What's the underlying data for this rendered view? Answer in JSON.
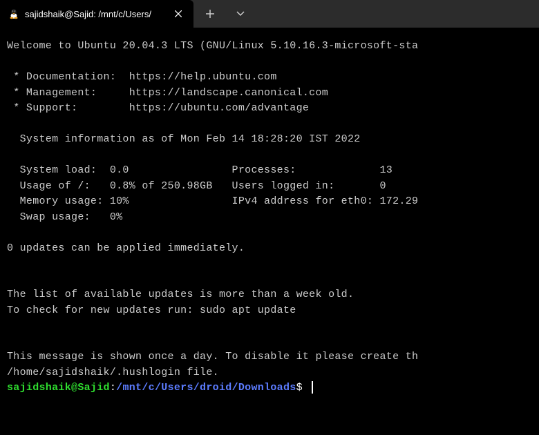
{
  "tab": {
    "title": "sajidshaik@Sajid: /mnt/c/Users/"
  },
  "terminal": {
    "welcome": "Welcome to Ubuntu 20.04.3 LTS (GNU/Linux 5.10.16.3-microsoft-sta",
    "links": {
      "documentation": " * Documentation:  https://help.ubuntu.com",
      "management": " * Management:     https://landscape.canonical.com",
      "support": " * Support:        https://ubuntu.com/advantage"
    },
    "sysinfo": {
      "header": "  System information as of Mon Feb 14 18:28:20 IST 2022",
      "load": "  System load:  0.0                Processes:             13",
      "usage": "  Usage of /:   0.8% of 250.98GB   Users logged in:       0",
      "memory": "  Memory usage: 10%                IPv4 address for eth0: 172.29",
      "swap": "  Swap usage:   0%"
    },
    "updates": "0 updates can be applied immediately.",
    "motd1": "The list of available updates is more than a week old.",
    "motd2": "To check for new updates run: sudo apt update",
    "hushlogin1": "This message is shown once a day. To disable it please create th",
    "hushlogin2": "/home/sajidshaik/.hushlogin file.",
    "prompt": {
      "user": "sajidshaik@Sajid",
      "colon": ":",
      "path": "/mnt/c/Users/droid/Downloads",
      "dollar": "$"
    }
  }
}
